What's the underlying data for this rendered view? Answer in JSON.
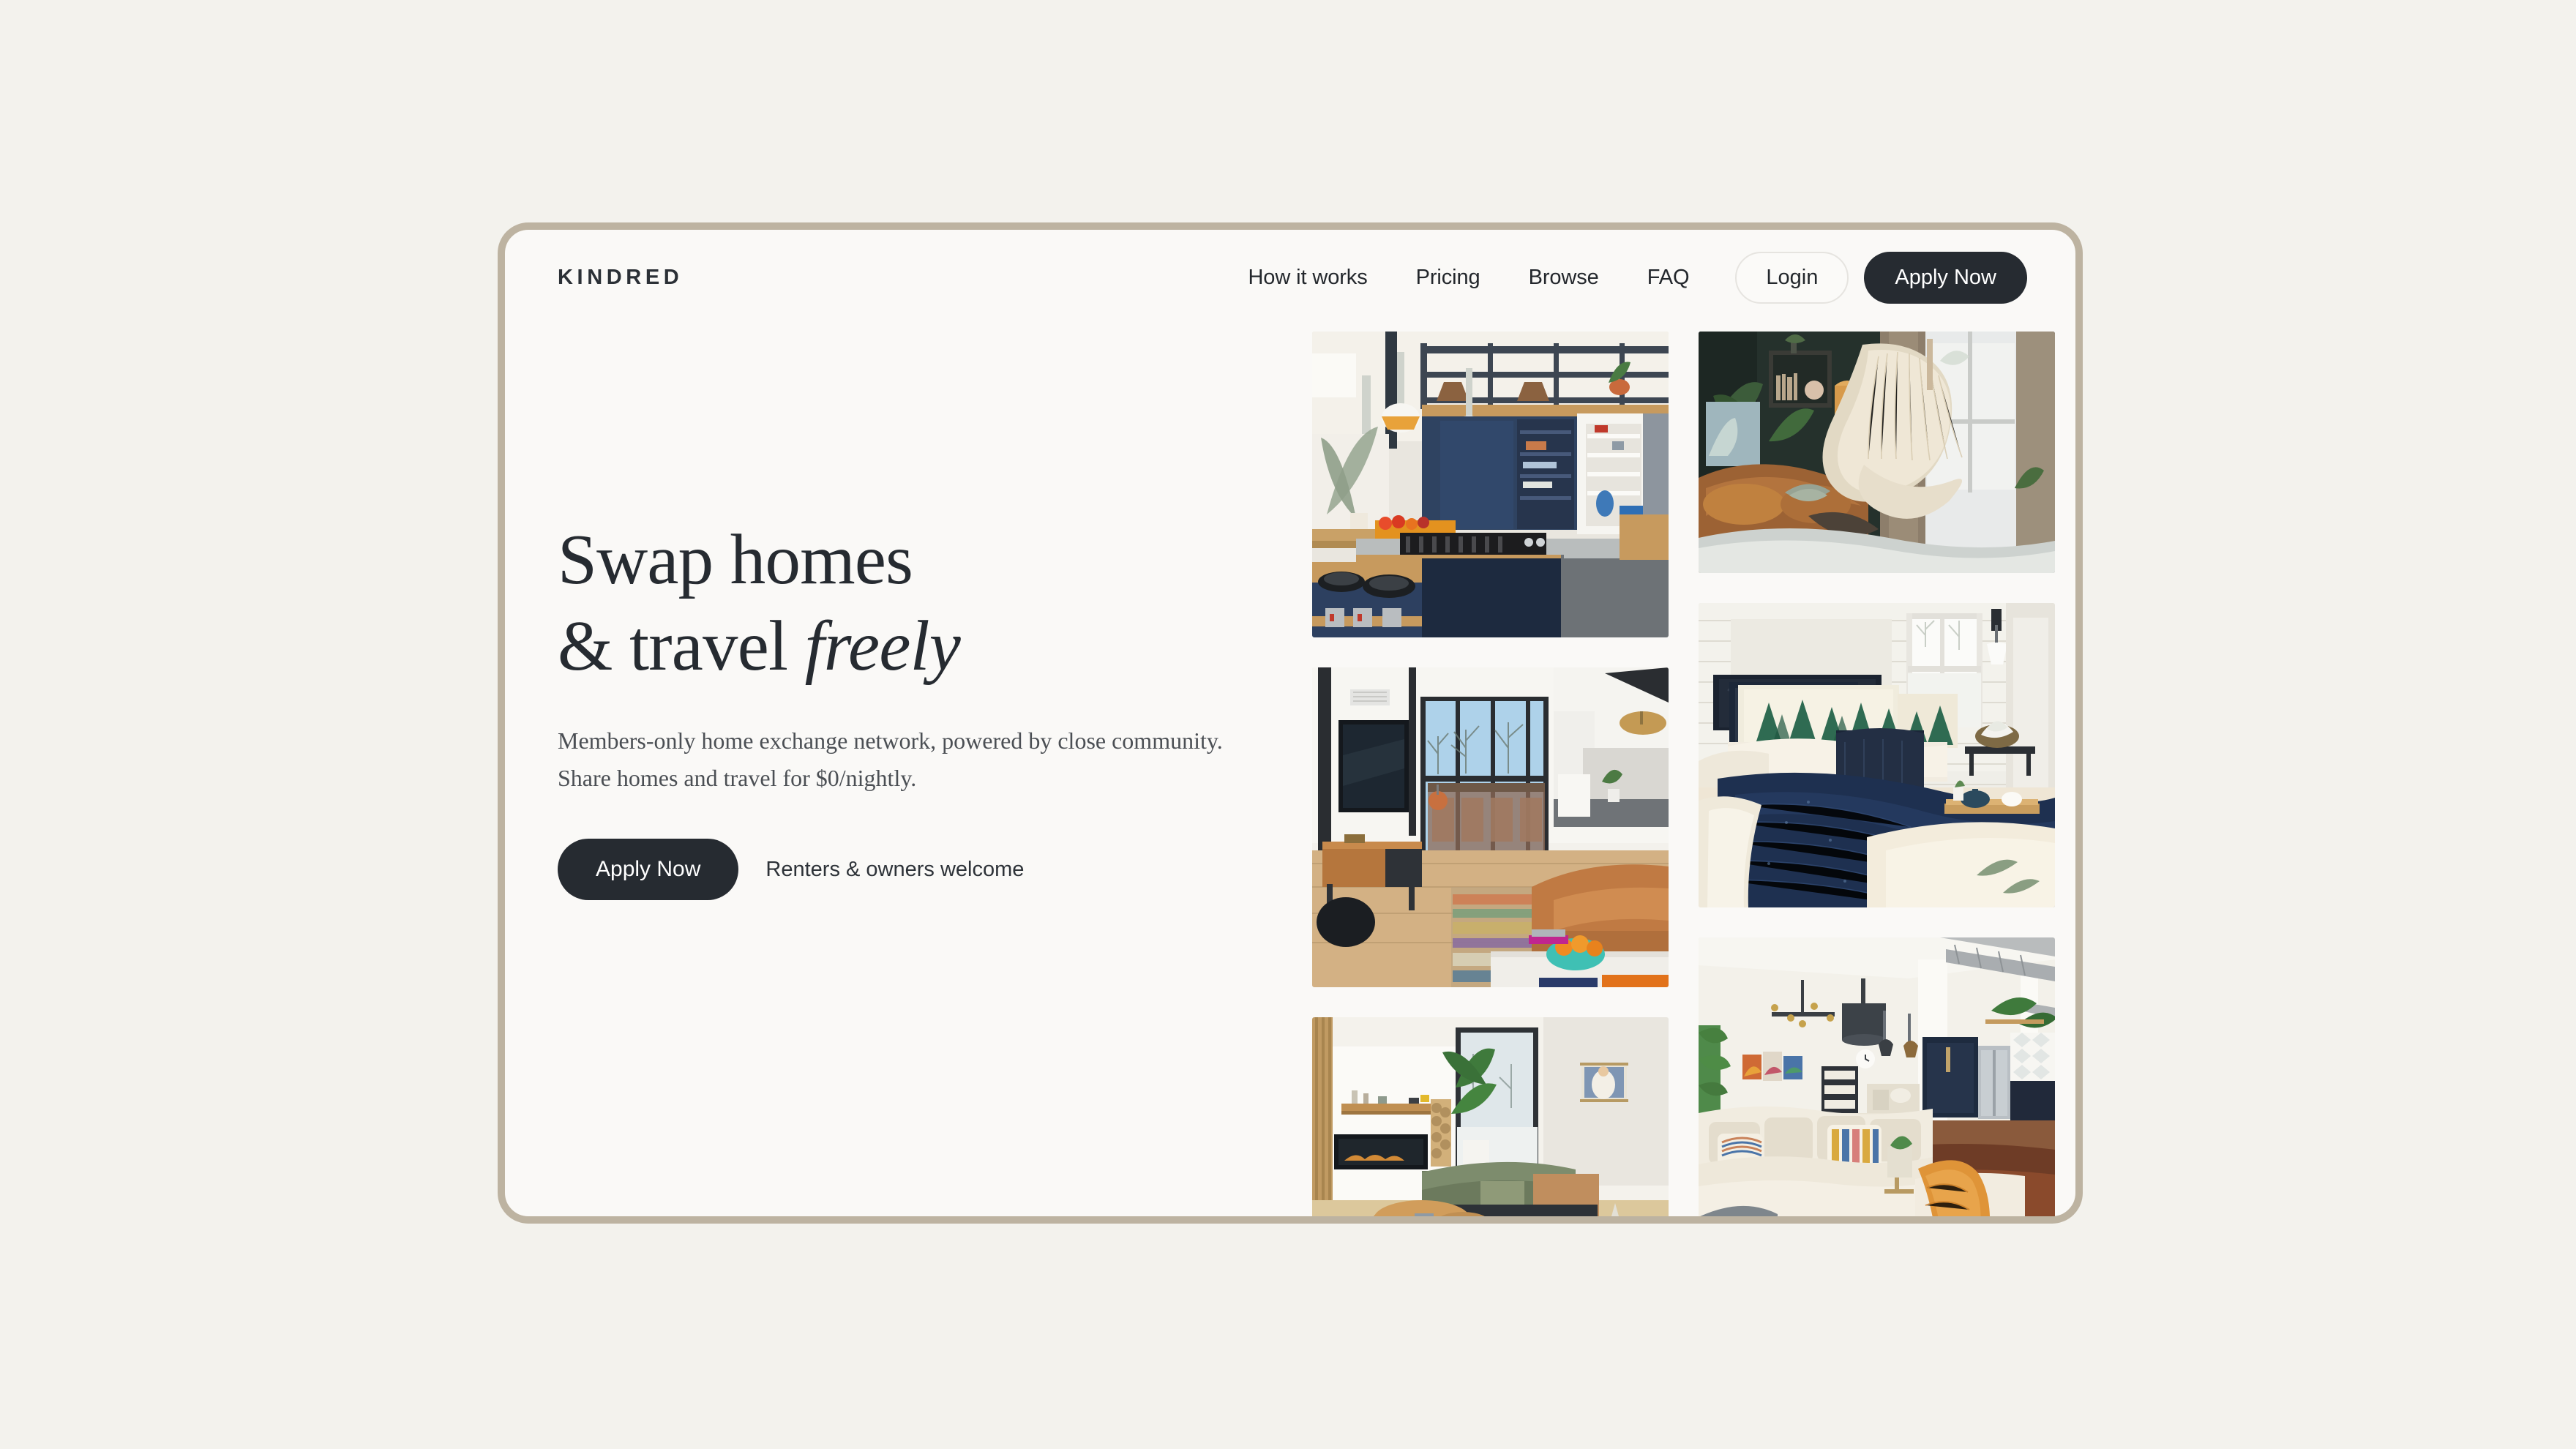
{
  "page": {
    "background_color": "#f3f2ed",
    "card_color": "#faf9f7",
    "frame_border_color": "#bdb3a1",
    "accent_dark": "#262b31"
  },
  "header": {
    "logo": "KINDRED",
    "nav_items": [
      {
        "label": "How it works"
      },
      {
        "label": "Pricing"
      },
      {
        "label": "Browse"
      },
      {
        "label": "FAQ"
      }
    ],
    "login_label": "Login",
    "apply_label": "Apply Now"
  },
  "hero": {
    "headline_line1": "Swap homes",
    "headline_line2_plain": "& travel ",
    "headline_line2_italic": "freely",
    "subhead_line1": "Members-only home exchange network, powered by close community.",
    "subhead_line2": "Share homes and travel for $0/nightly.",
    "cta_primary": "Apply Now",
    "cta_note": "Renters & owners welcome"
  },
  "gallery": {
    "left_column": [
      {
        "name": "loft-kitchen-navy-cabinets"
      },
      {
        "name": "double-height-loft-living-room"
      },
      {
        "name": "mountain-modern-fireplace-living-room"
      }
    ],
    "right_column": [
      {
        "name": "hammock-chair-reading-nook"
      },
      {
        "name": "cabin-bedroom-navy-quilt"
      },
      {
        "name": "industrial-loft-sectional"
      }
    ]
  }
}
